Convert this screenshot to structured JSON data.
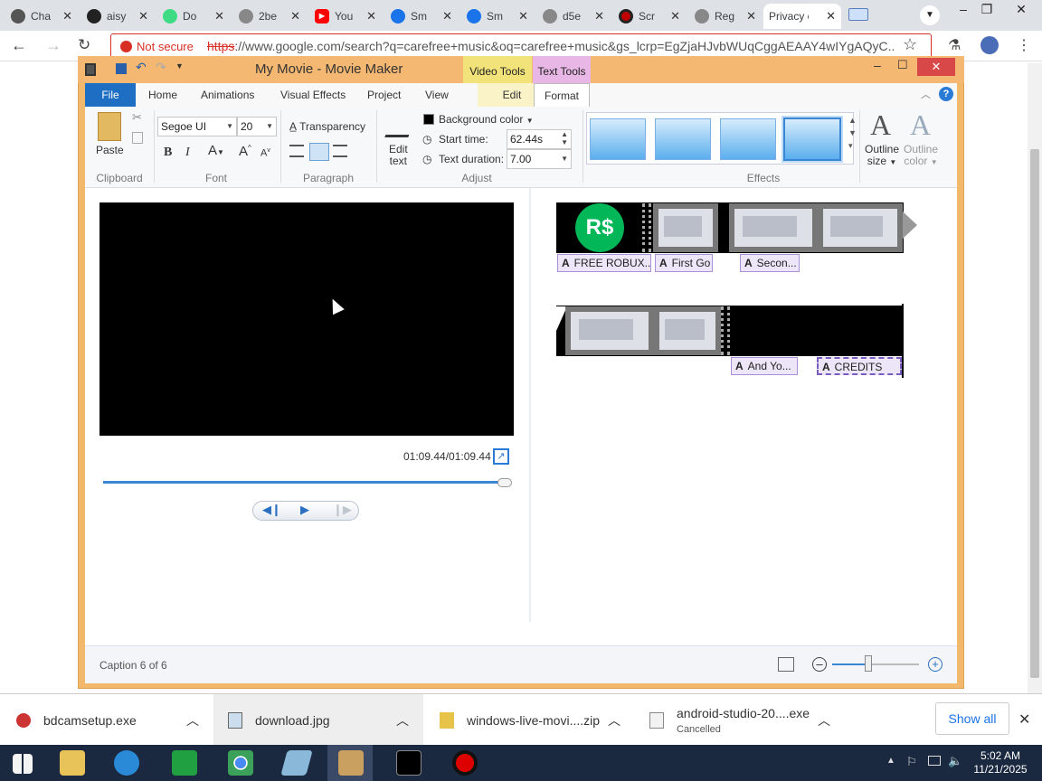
{
  "browser": {
    "tabs": [
      {
        "title": "Cha",
        "icon": "openai-icon",
        "color": "#444444"
      },
      {
        "title": "aisy",
        "icon": "github-icon",
        "color": "#222222"
      },
      {
        "title": "Do",
        "icon": "android-icon",
        "color": "#3ddc84"
      },
      {
        "title": "2be",
        "icon": "globe-icon",
        "color": "#777777"
      },
      {
        "title": "You",
        "icon": "youtube-icon",
        "color": "#ff0000"
      },
      {
        "title": "Sm",
        "icon": "smashing-icon",
        "color": "#1a73e8"
      },
      {
        "title": "Sm",
        "icon": "smashing-icon",
        "color": "#1a73e8"
      },
      {
        "title": "d5e",
        "icon": "globe-icon",
        "color": "#777777"
      },
      {
        "title": "Scr",
        "icon": "record-icon",
        "color": "#c00000"
      },
      {
        "title": "Reg",
        "icon": "globe-icon",
        "color": "#777777"
      },
      {
        "title": "Privacy c",
        "icon": "none",
        "color": "#ffffff"
      }
    ],
    "not_secure": "Not secure",
    "url_scheme": "https",
    "url_rest": "://www.google.com/search?q=carefree+music&oq=carefree+music&gs_lcrp=EgZjaHJvbWUqCggAEAAY4wIYgAQyC..."
  },
  "moviemaker": {
    "title": "My Movie - Movie Maker",
    "context_tabs": {
      "video_tools": "Video Tools",
      "text_tools": "Text Tools"
    },
    "tabs": [
      "File",
      "Home",
      "Animations",
      "Visual Effects",
      "Project",
      "View",
      "Edit",
      "Format"
    ],
    "clipboard": {
      "paste": "Paste",
      "group": "Clipboard"
    },
    "font": {
      "family": "Segoe UI",
      "size": "20",
      "group": "Font",
      "bold": "B",
      "italic": "I"
    },
    "paragraph": {
      "transparency": "Transparency",
      "group": "Paragraph"
    },
    "adjust": {
      "background_color": "Background color",
      "edit_text": [
        "Edit",
        "text"
      ],
      "start_time_label": "Start time:",
      "start_time": "62.44s",
      "text_duration_label": "Text duration:",
      "text_duration": "7.00",
      "group": "Adjust"
    },
    "effects": {
      "group": "Effects",
      "outline_size": [
        "Outline",
        "size"
      ],
      "outline_color": [
        "Outline",
        "color"
      ]
    },
    "preview": {
      "time": "01:09.44/01:09.44",
      "progress": 1.0
    },
    "captions_row1": [
      "FREE ROBUX...",
      "First Go",
      "Secon..."
    ],
    "captions_row2": [
      "And Yo...",
      "CREDITS"
    ],
    "robux_logo": "R$",
    "status": "Caption 6 of 6"
  },
  "downloads": [
    {
      "name": "bdcamsetup.exe",
      "status": ""
    },
    {
      "name": "download.jpg",
      "status": ""
    },
    {
      "name": "windows-live-movi....zip",
      "status": ""
    },
    {
      "name": "android-studio-20....exe",
      "status": "Cancelled"
    }
  ],
  "show_all": "Show all",
  "clock": {
    "time": "5:02 AM",
    "date": "11/21/2025"
  }
}
